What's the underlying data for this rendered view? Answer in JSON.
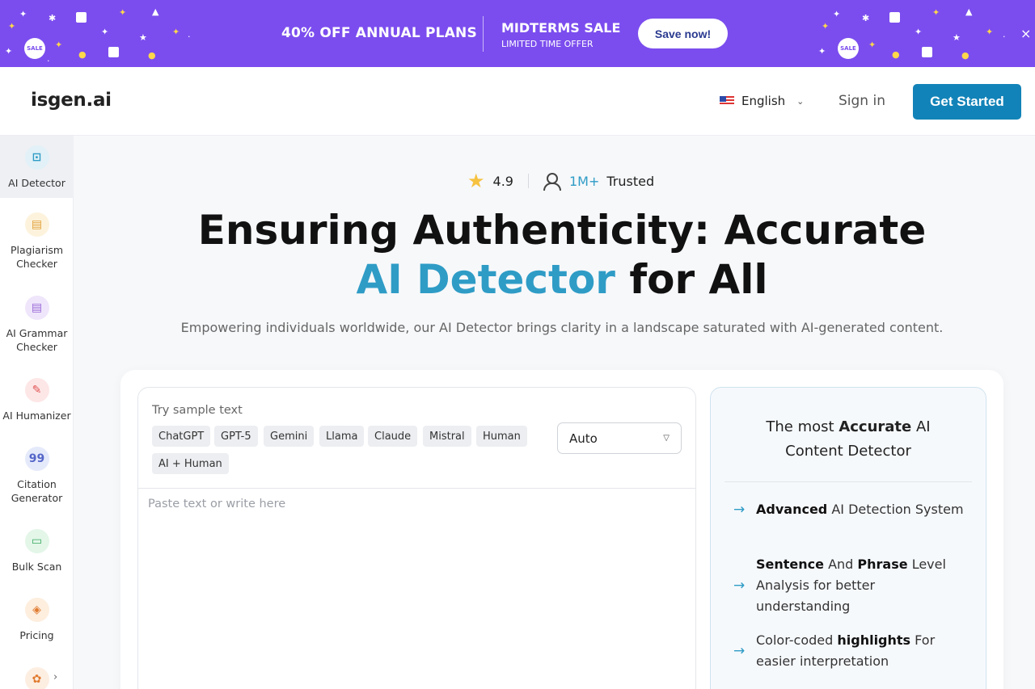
{
  "promo": {
    "headline": "40% OFF ANNUAL PLANS",
    "sale_title": "MIDTERMS SALE",
    "sale_subtitle": "LIMITED TIME OFFER",
    "button_label": "Save now!",
    "close_icon": "×",
    "badge_text": "SALE",
    "bg_color": "#7b4dee"
  },
  "header": {
    "logo": "isgen.ai",
    "language": "English",
    "sign_in": "Sign in",
    "get_started": "Get Started",
    "accent_color": "#1283b8"
  },
  "sidebar": {
    "items": [
      {
        "label": "AI Detector",
        "icon": "ai-detector-icon",
        "active": true
      },
      {
        "label": "Plagiarism Checker",
        "icon": "plagiarism-icon",
        "active": false
      },
      {
        "label": "AI Grammar Checker",
        "icon": "grammar-icon",
        "active": false
      },
      {
        "label": "AI Humanizer",
        "icon": "humanizer-icon",
        "active": false
      },
      {
        "label": "Citation Generator",
        "icon": "citation-icon",
        "active": false
      },
      {
        "label": "Bulk Scan",
        "icon": "folder-icon",
        "active": false
      },
      {
        "label": "Pricing",
        "icon": "price-tag-icon",
        "active": false
      }
    ],
    "more_icon": "›"
  },
  "hero": {
    "rating": "4.9",
    "trusted_count": "1M+",
    "trusted_label": "Trusted",
    "title_line1": "Ensuring Authenticity: Accurate",
    "title_accent": "AI Detector",
    "title_rest": "for All",
    "subtitle": "Empowering individuals worldwide, our AI Detector brings clarity in a landscape saturated with AI-generated content."
  },
  "editor": {
    "try_label": "Try sample text",
    "samples": [
      "ChatGPT",
      "GPT-5",
      "Gemini",
      "Llama",
      "Claude",
      "Mistral",
      "Human",
      "AI + Human"
    ],
    "mode_selected": "Auto",
    "placeholder": "Paste text or write here"
  },
  "info": {
    "title_pre": "The most ",
    "title_bold": "Accurate",
    "title_post": " AI",
    "title_line2": "Content Detector",
    "features": [
      {
        "bold": "Advanced",
        "rest": " AI Detection System"
      },
      {
        "bold": "Sentence",
        "mid": " And ",
        "bold2": "Phrase",
        "rest": " Level Analysis for better understanding"
      },
      {
        "pre": "Color-coded ",
        "bold": "highlights",
        "rest": " For easier interpretation"
      }
    ]
  }
}
